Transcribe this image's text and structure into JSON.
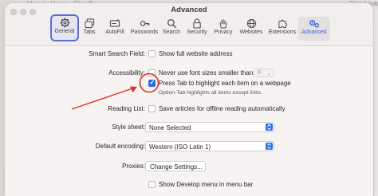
{
  "background": {
    "tab_text": "bhop | • Home • Shopify",
    "tab_text_right": "Storybook"
  },
  "window": {
    "title": "Advanced"
  },
  "toolbar": {
    "items": [
      {
        "label": "General",
        "icon": "gear-icon"
      },
      {
        "label": "Tabs",
        "icon": "tabs-icon"
      },
      {
        "label": "AutoFill",
        "icon": "autofill-icon"
      },
      {
        "label": "Passwords",
        "icon": "key-icon"
      },
      {
        "label": "Search",
        "icon": "search-icon"
      },
      {
        "label": "Security",
        "icon": "lock-icon"
      },
      {
        "label": "Privacy",
        "icon": "hand-icon"
      },
      {
        "label": "Websites",
        "icon": "globe-icon"
      },
      {
        "label": "Extensions",
        "icon": "puzzle-icon"
      },
      {
        "label": "Advanced",
        "icon": "gears-icon"
      }
    ],
    "selected": "Advanced"
  },
  "settings": {
    "smart_search": {
      "label": "Smart Search Field:",
      "option": "Show full website address",
      "checked": false
    },
    "accessibility": {
      "label": "Accessibility:",
      "font_option": "Never use font sizes smaller than",
      "font_checked": false,
      "font_size": "9",
      "tab_option": "Press Tab to highlight each item on a webpage",
      "tab_checked": true,
      "tab_hint": "Option-Tab highlights all items except links."
    },
    "reading_list": {
      "label": "Reading List:",
      "option": "Save articles for offline reading automatically",
      "checked": false
    },
    "style_sheet": {
      "label": "Style sheet:",
      "value": "None Selected"
    },
    "encoding": {
      "label": "Default encoding:",
      "value": "Western (ISO Latin 1)"
    },
    "proxies": {
      "label": "Proxies:",
      "button": "Change Settings..."
    },
    "develop": {
      "option": "Show Develop menu in menu bar",
      "checked": false
    }
  },
  "colors": {
    "accent": "#2b6de0",
    "annotation": "#e0321f",
    "selected_outline": "#5b6fd6"
  }
}
